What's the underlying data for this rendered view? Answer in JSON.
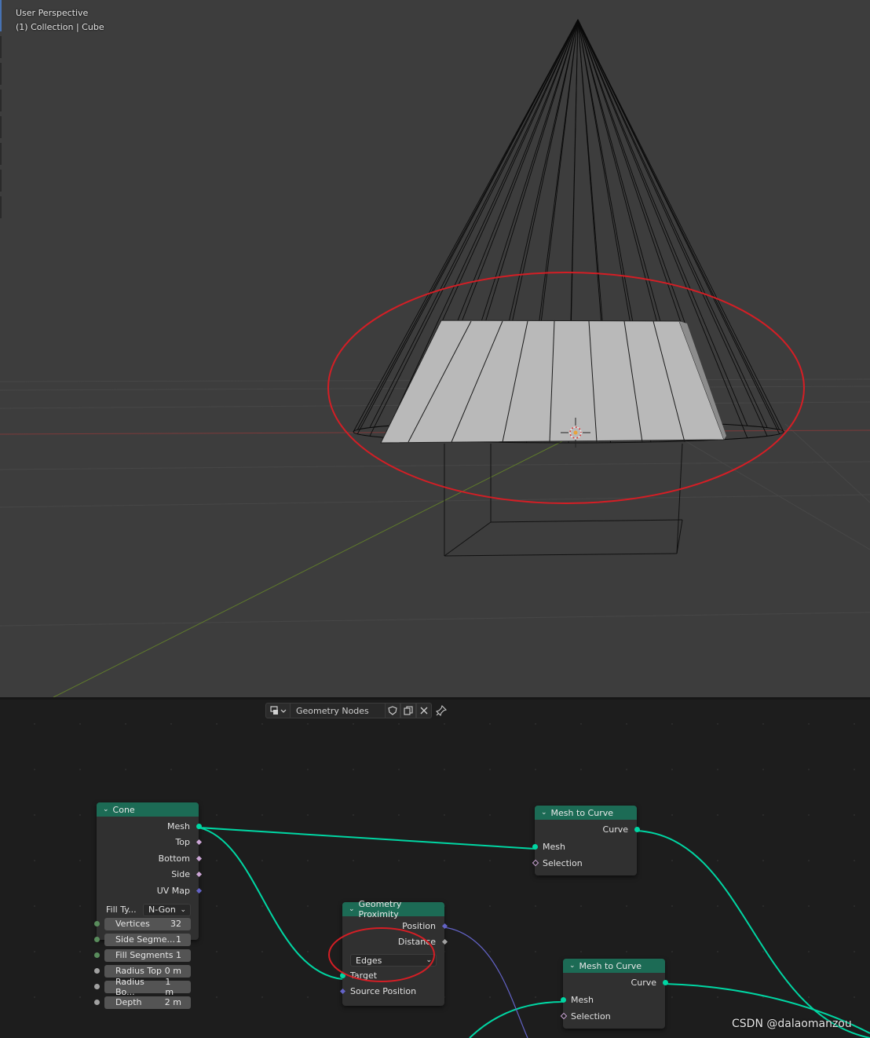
{
  "viewport": {
    "view_name": "User Perspective",
    "collection_path": "(1) Collection | Cube"
  },
  "node_editor": {
    "tree_name": "Geometry Nodes",
    "icons": {
      "editor_type": "node-editor-icon",
      "fake_user": "shield-icon",
      "duplicate": "duplicate-icon",
      "unlink": "close-icon",
      "pin": "pin-icon"
    }
  },
  "nodes": {
    "cone": {
      "title": "Cone",
      "outputs": [
        "Mesh",
        "Top",
        "Bottom",
        "Side",
        "UV Map"
      ],
      "fill_type_label": "Fill Ty...",
      "fill_type_value": "N-Gon",
      "fields": [
        {
          "label": "Vertices",
          "value": "32"
        },
        {
          "label": "Side Segme...",
          "value": "1"
        },
        {
          "label": "Fill Segments",
          "value": "1"
        },
        {
          "label": "Radius Top",
          "value": "0 m"
        },
        {
          "label": "Radius Bo...",
          "value": "1 m"
        },
        {
          "label": "Depth",
          "value": "2 m"
        }
      ]
    },
    "geometry_proximity": {
      "title": "Geometry Proximity",
      "outputs": [
        "Position",
        "Distance"
      ],
      "mode": "Edges",
      "inputs": [
        "Target",
        "Source Position"
      ]
    },
    "mesh_to_curve_1": {
      "title": "Mesh to Curve",
      "output": "Curve",
      "inputs": [
        "Mesh",
        "Selection"
      ]
    },
    "mesh_to_curve_2": {
      "title": "Mesh to Curve",
      "output": "Curve",
      "inputs": [
        "Mesh",
        "Selection"
      ]
    }
  },
  "colors": {
    "node_header": "#1c6b55",
    "geometry_socket": "#00d6a3",
    "vector_socket": "#6363c7",
    "annotation": "#d41e25"
  },
  "watermark": "CSDN @dalaomanzou"
}
